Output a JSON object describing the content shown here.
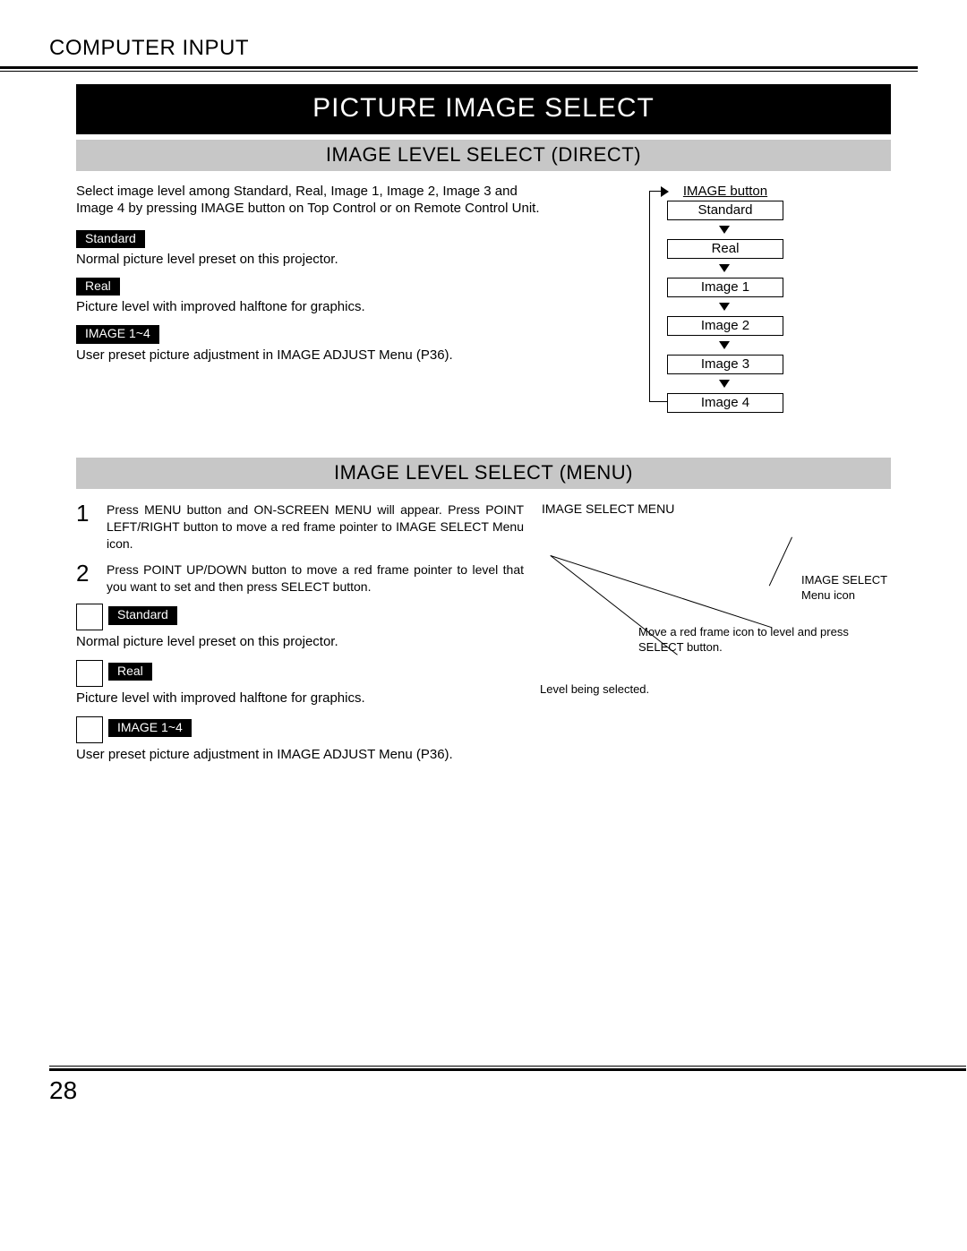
{
  "header": {
    "section": "COMPUTER INPUT",
    "title": "PICTURE IMAGE SELECT"
  },
  "direct": {
    "subtitle": "IMAGE LEVEL SELECT (DIRECT)",
    "intro": "Select image level among Standard, Real, Image 1, Image 2, Image 3 and Image 4 by pressing IMAGE button on Top Control or on Remote Control Unit.",
    "items": [
      {
        "label": "Standard",
        "desc": "Normal picture level preset on this projector."
      },
      {
        "label": "Real",
        "desc": "Picture level with improved halftone for graphics."
      },
      {
        "label": "IMAGE 1~4",
        "desc": "User preset picture adjustment in IMAGE ADJUST Menu (P36)."
      }
    ],
    "flow": {
      "title": "IMAGE button",
      "boxes": [
        "Standard",
        "Real",
        "Image 1",
        "Image 2",
        "Image 3",
        "Image 4"
      ]
    }
  },
  "menu": {
    "subtitle": "IMAGE LEVEL SELECT (MENU)",
    "steps": [
      {
        "num": "1",
        "text": "Press MENU button and ON-SCREEN MENU will appear.  Press POINT LEFT/RIGHT button to move a red frame pointer to IMAGE SELECT Menu icon."
      },
      {
        "num": "2",
        "text": "Press POINT UP/DOWN button to move a red frame pointer to level that you want to set and then press SELECT button."
      }
    ],
    "items": [
      {
        "label": "Standard",
        "desc": "Normal picture level preset on this projector."
      },
      {
        "label": "Real",
        "desc": "Picture level with improved halftone for graphics."
      },
      {
        "label": "IMAGE 1~4",
        "desc": "User preset picture adjustment in IMAGE ADJUST Menu (P36)."
      }
    ],
    "right": {
      "title": "IMAGE SELECT MENU",
      "callout_icon": "IMAGE SELECT\nMenu icon",
      "callout_move": "Move a red frame icon to level and press SELECT button.",
      "callout_level": "Level being selected."
    }
  },
  "page_number": "28"
}
